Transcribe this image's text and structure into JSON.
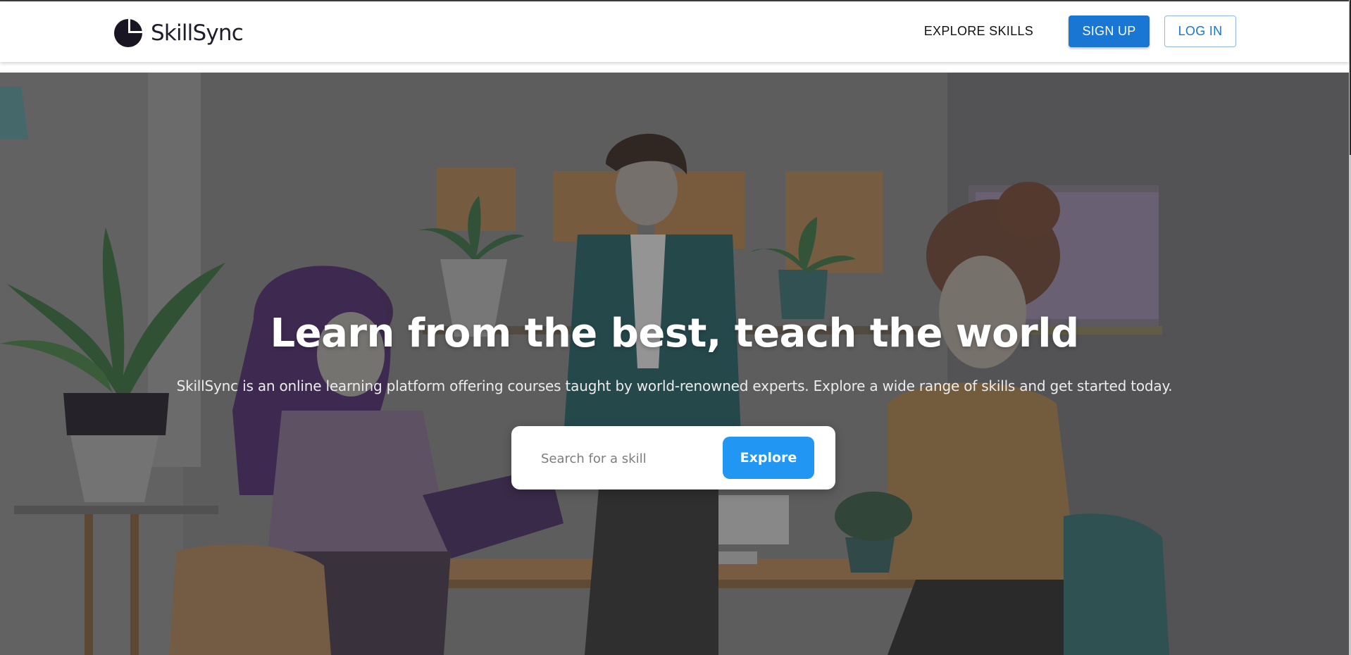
{
  "navbar": {
    "brand_name": "SkillSync",
    "explore_label": "EXPLORE SKILLS",
    "signup_label": "SIGN UP",
    "login_label": "LOG IN"
  },
  "hero": {
    "title": "Learn from the best, teach the world",
    "subtitle": "SkillSync is an online learning platform offering courses taught by world-renowned experts. Explore a wide range of skills and get started today.",
    "search_placeholder": "Search for a skill",
    "search_value": "",
    "explore_button": "Explore"
  },
  "colors": {
    "primary": "#1976d2",
    "explore": "#2196f3",
    "overlay": "#5e5e5e",
    "brand_mark": "#1a1523"
  },
  "icons": {
    "brand_logo": "logo-mark-icon"
  }
}
